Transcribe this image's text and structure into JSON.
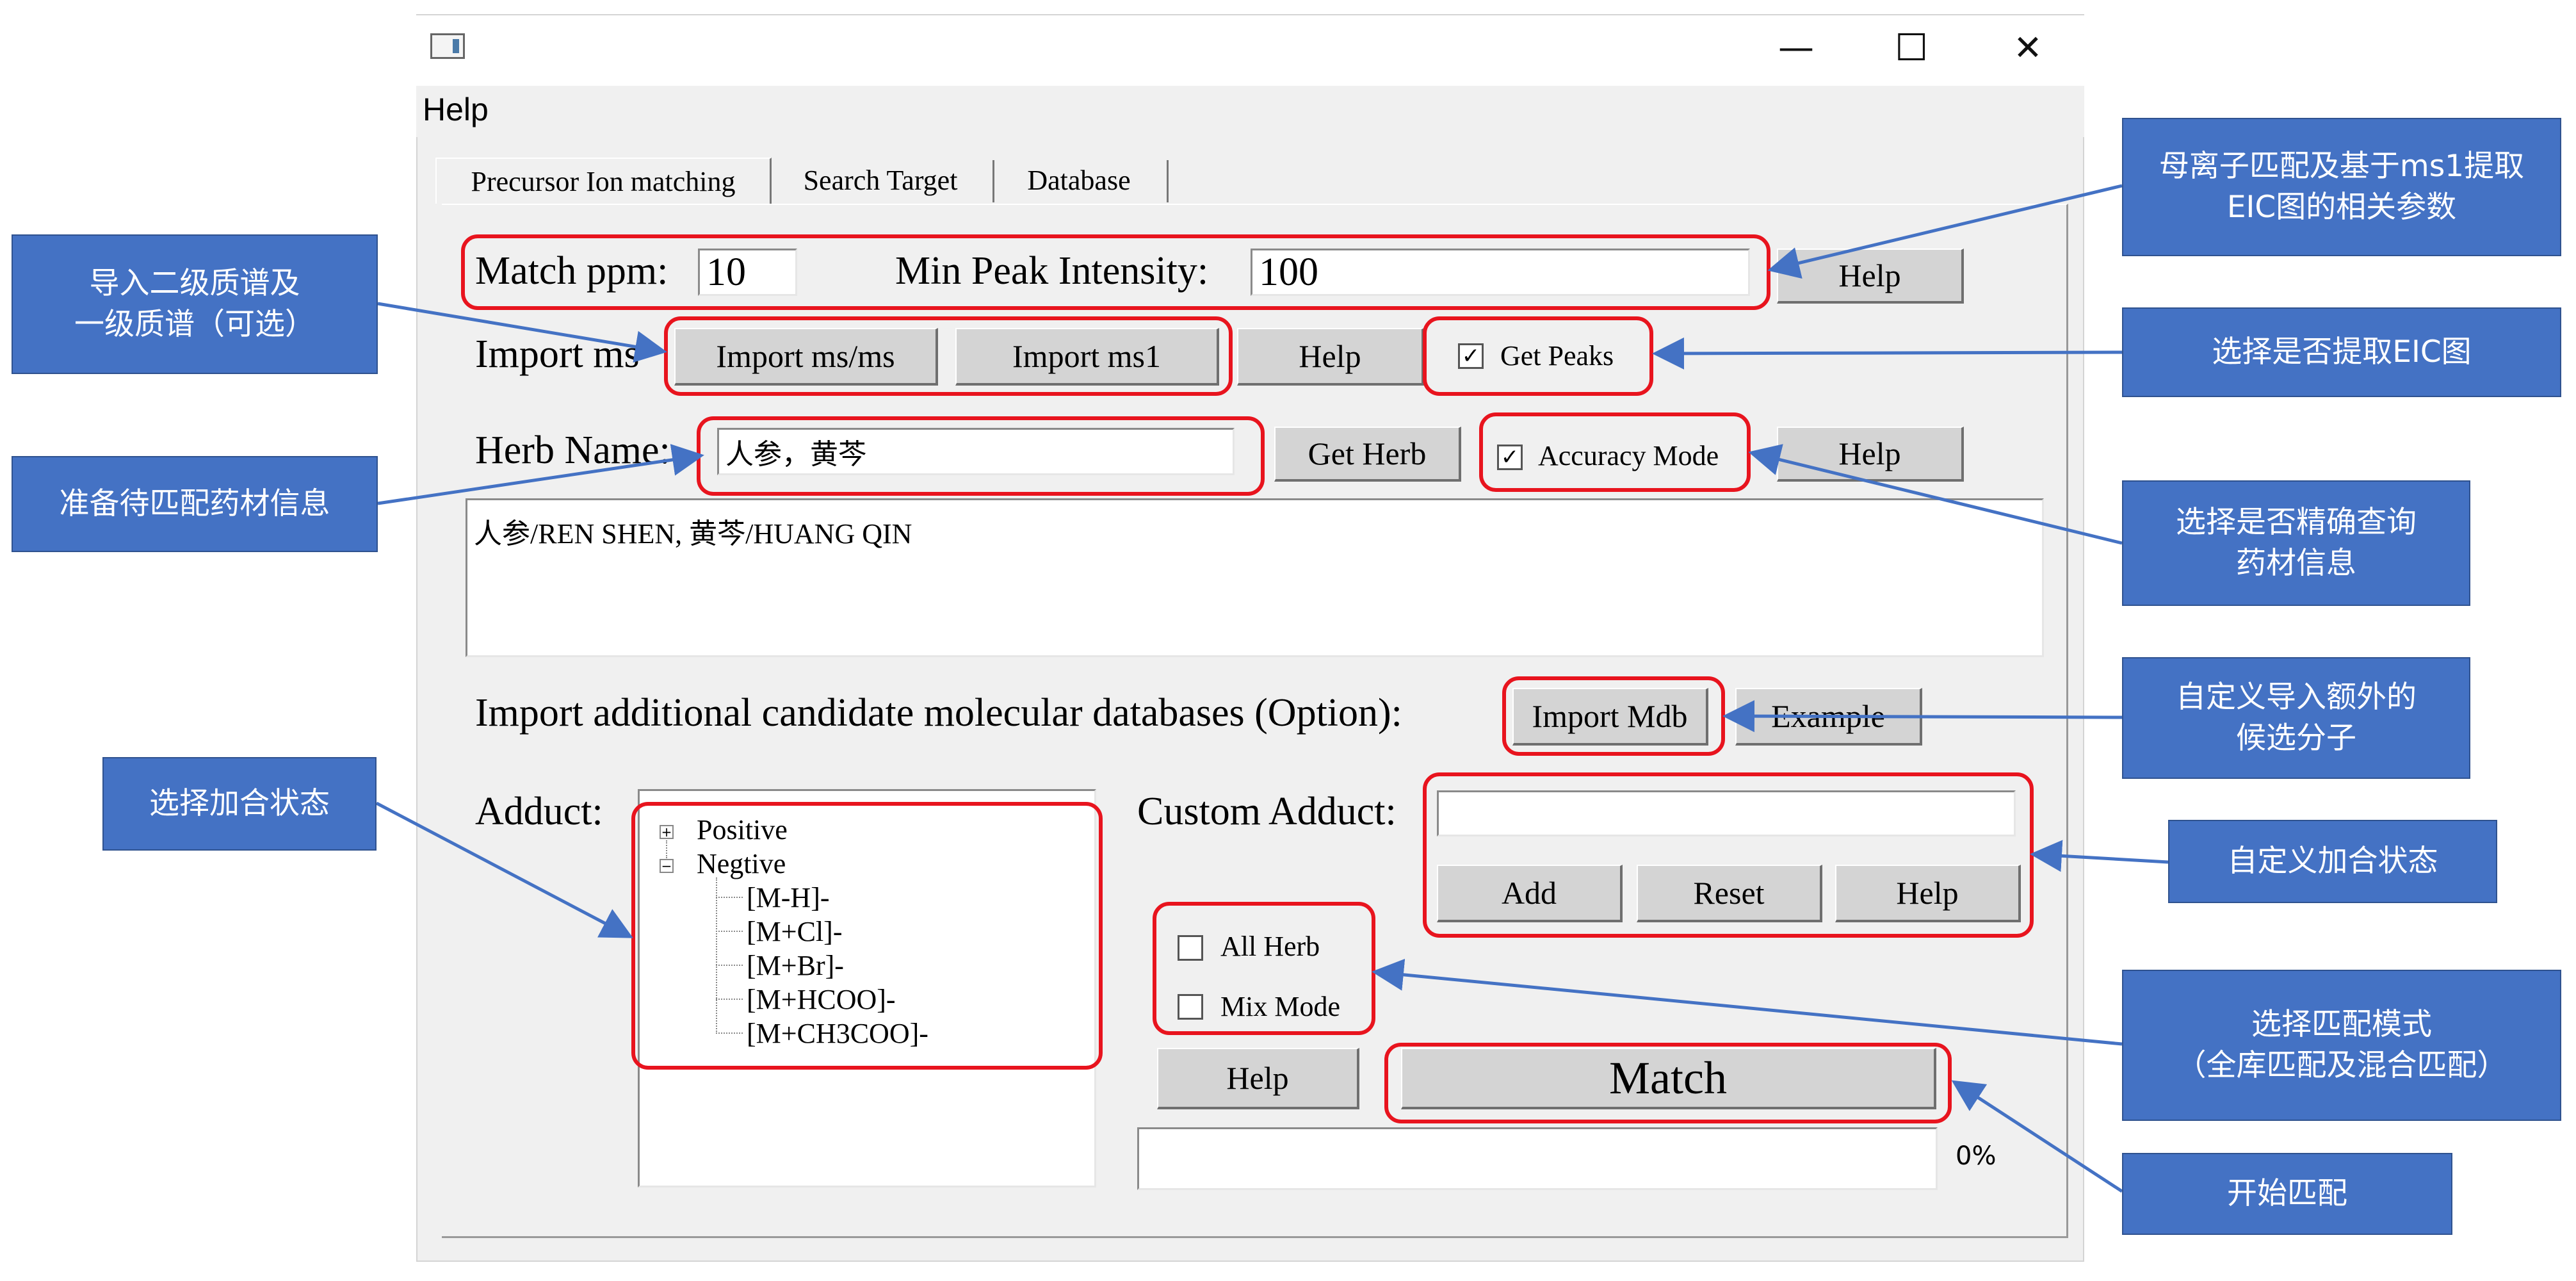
{
  "window": {
    "minimize": "—",
    "maximize": "☐",
    "close": "✕"
  },
  "menu": {
    "help": "Help"
  },
  "tabs": [
    "Precursor Ion matching",
    "Search Target",
    "Database"
  ],
  "params": {
    "match_ppm_label": "Match ppm:",
    "match_ppm_value": "10",
    "min_peak_label": "Min Peak Intensity:",
    "min_peak_value": "100",
    "help1": "Help"
  },
  "import": {
    "label": "Import ms",
    "msms_button": "Import ms/ms",
    "ms1_button": "Import ms1",
    "help": "Help",
    "get_peaks_label": "Get Peaks",
    "get_peaks_checked": true
  },
  "herb": {
    "label": "Herb Name:",
    "input_value": "人参，黄芩",
    "get_herb_button": "Get Herb",
    "accuracy_label": "Accuracy Mode",
    "accuracy_checked": true,
    "help": "Help",
    "result_text": "人参/REN SHEN, 黄芩/HUANG QIN"
  },
  "mdb": {
    "label": "Import additional candidate molecular databases (Option):",
    "import_button": "Import Mdb",
    "example_button": "Example"
  },
  "adduct": {
    "label": "Adduct:",
    "tree": {
      "positive": "Positive",
      "negative": "Negtive",
      "negative_children": [
        "[M-H]-",
        "[M+Cl]-",
        "[M+Br]-",
        "[M+HCOO]-",
        "[M+CH3COO]-"
      ]
    },
    "custom_label": "Custom Adduct:",
    "custom_value": "",
    "add_button": "Add",
    "reset_button": "Reset",
    "help_button": "Help"
  },
  "mode": {
    "all_herb_label": "All Herb",
    "all_herb_checked": false,
    "mix_mode_label": "Mix Mode",
    "mix_mode_checked": false
  },
  "actions": {
    "help": "Help",
    "match": "Match",
    "progress_text": "0%",
    "progress": 0
  },
  "annotations": {
    "import_spectra": "导入二级质谱及\n一级质谱（可选）",
    "prepare_herb": "准备待匹配药材信息",
    "adduct_select": "选择加合状态",
    "params": "母离子匹配及基于ms1提取\nEIC图的相关参数",
    "get_eic": "选择是否提取EIC图",
    "accuracy": "选择是否精确查询\n药材信息",
    "custom_mol": "自定义导入额外的\n候选分子",
    "custom_adduct": "自定义加合状态",
    "match_mode": "选择匹配模式\n（全库匹配及混合匹配）",
    "start": "开始匹配"
  },
  "colors": {
    "annotation_bg": "#4472c4",
    "highlight": "#e8141e",
    "window_bg": "#f0f0f0",
    "button_bg": "#d4d4d4"
  }
}
